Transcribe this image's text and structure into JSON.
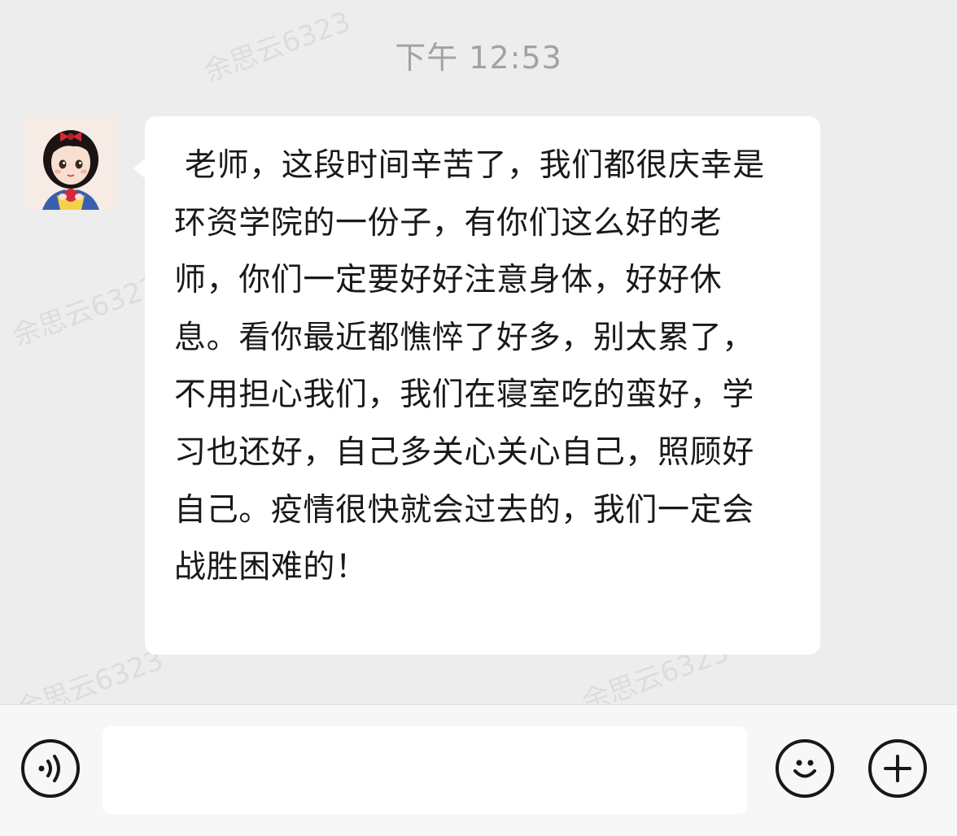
{
  "chat": {
    "timestamp": "下午 12:53",
    "watermark": "余思云6323",
    "messages": [
      {
        "sender_avatar": "avatar-cartoon-girl",
        "text": " 老师，这段时间辛苦了，我们都很庆幸是环资学院的一份子，有你们这么好的老师，你们一定要好好注意身体，好好休息。看你最近都憔悴了好多，别太累了，不用担心我们，我们在寝室吃的蛮好，学习也还好，自己多关心关心自己，照顾好自己。疫情很快就会过去的，我们一定会战胜困难的！"
      }
    ]
  },
  "input_bar": {
    "text_value": "",
    "icons": {
      "voice": "voice-icon",
      "emoji": "emoji-icon",
      "more": "plus-icon"
    }
  },
  "colors": {
    "chat_background": "#ededed",
    "bubble": "#ffffff",
    "timestamp": "#a2a2a2",
    "text": "#191919",
    "input_bar": "#f7f7f7"
  }
}
